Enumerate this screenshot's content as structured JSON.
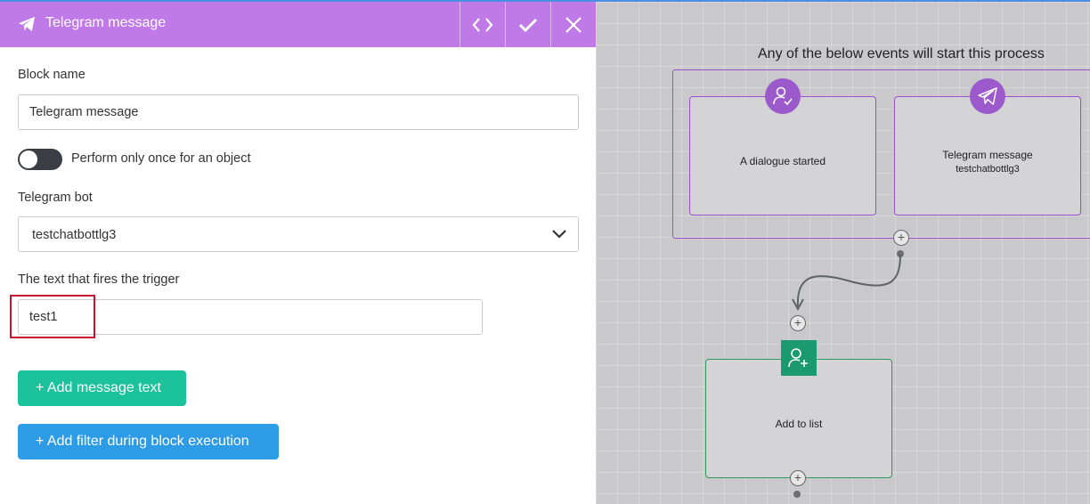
{
  "panel": {
    "title": "Telegram message",
    "header_buttons": {
      "code": "code-icon",
      "save": "check-icon",
      "close": "close-icon"
    },
    "block_name_label": "Block name",
    "block_name_value": "Telegram message",
    "toggle_label": "Perform only once for an object",
    "toggle_on": false,
    "bot_label": "Telegram bot",
    "bot_value": "testchatbottlg3",
    "trigger_label": "The text that fires the trigger",
    "trigger_value": "test1",
    "add_message_button": "+ Add message text",
    "add_filter_button": "+ Add filter during block execution"
  },
  "canvas": {
    "heading": "Any of the below events will start this process",
    "nodes": [
      {
        "icon": "user-check-icon",
        "title": "A dialogue started",
        "subtitle": ""
      },
      {
        "icon": "telegram-icon",
        "title": "Telegram message",
        "subtitle": "testchatbottlg3"
      },
      {
        "icon": "user-add-icon",
        "title": "Add to list",
        "subtitle": ""
      }
    ]
  },
  "colors": {
    "header": "#c07ae8",
    "green_button": "#1bc29b",
    "blue_button": "#2e9be6",
    "trigger_border": "#9b4fd0",
    "action_border": "#2e9a5e",
    "highlight": "#c8102e"
  }
}
